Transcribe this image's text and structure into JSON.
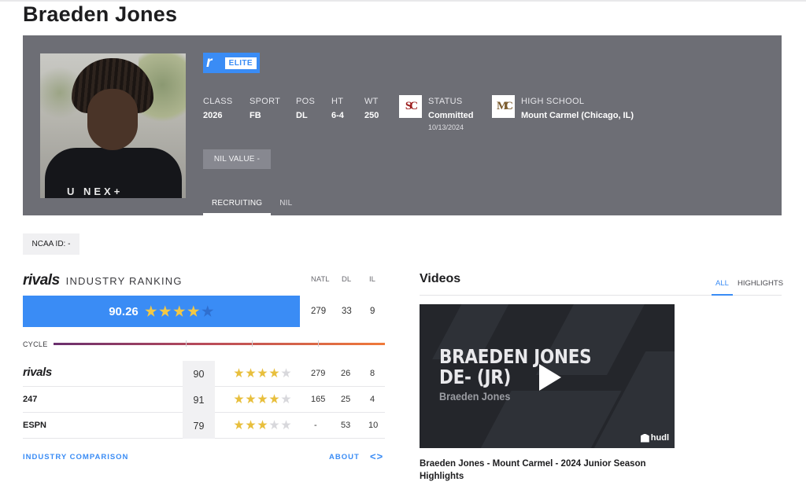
{
  "player": {
    "name": "Braeden Jones"
  },
  "badge": {
    "label": "ELITE"
  },
  "stats": [
    {
      "label": "CLASS",
      "value": "2026"
    },
    {
      "label": "SPORT",
      "value": "FB"
    },
    {
      "label": "POS",
      "value": "DL"
    },
    {
      "label": "HT",
      "value": "6-4"
    },
    {
      "label": "WT",
      "value": "250"
    }
  ],
  "status": {
    "label": "STATUS",
    "value": "Committed",
    "date": "10/13/2024",
    "school_logo_text": "SC"
  },
  "high_school": {
    "label": "HIGH SCHOOL",
    "value": "Mount Carmel (Chicago, IL)",
    "logo_text": "MC"
  },
  "nil_button": "NIL VALUE -",
  "tabs": [
    "RECRUITING",
    "NIL"
  ],
  "ncaa": "NCAA ID:  -",
  "ranking": {
    "brand": "rivals",
    "title": "INDUSTRY RANKING",
    "headers": [
      "NATL",
      "DL",
      "IL"
    ],
    "rating": "90.26",
    "stars": 4,
    "values": [
      "279",
      "33",
      "9"
    ],
    "cycle_label": "CYCLE",
    "sites": [
      {
        "name": "rivals",
        "score": "90",
        "stars": 4,
        "natl": "279",
        "pos": "26",
        "state": "8"
      },
      {
        "name": "247",
        "score": "91",
        "stars": 4,
        "natl": "165",
        "pos": "25",
        "state": "4"
      },
      {
        "name": "ESPN",
        "score": "79",
        "stars": 3,
        "natl": "-",
        "pos": "53",
        "state": "10"
      }
    ],
    "industry_comparison": "INDUSTRY COMPARISON",
    "about": "ABOUT",
    "code_icon": "<>"
  },
  "videos": {
    "title": "Videos",
    "tabs": [
      "ALL",
      "HIGHLIGHTS"
    ],
    "thumb_title_line1": "BRAEDEN JONES",
    "thumb_title_line2": "DE- (JR)",
    "thumb_subtitle": "Braeden Jones",
    "thumb_brand": "hudl",
    "caption": "Braeden Jones - Mount Carmel - 2024 Junior Season Highlights"
  },
  "colors": {
    "hero_bg": "#6d6e75",
    "accent": "#3a8cf5",
    "star": "#f3c845"
  }
}
